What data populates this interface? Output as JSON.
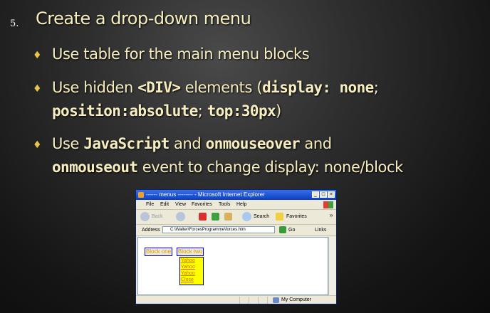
{
  "slide": {
    "number": "5.",
    "title": "Create a drop-down menu",
    "bullets": {
      "b1": {
        "text": "Use table for the main menu blocks"
      },
      "b2": {
        "pre": "Use hidden ",
        "code1": "<DIV>",
        "mid": " elements (",
        "code2": "display:  none",
        "sep": "; ",
        "code3": "position:absolute",
        "sep2": "; ",
        "code4": "top:30px",
        "end": ")"
      },
      "b3": {
        "pre": "Use ",
        "code1": "JavaScript",
        "mid": " and ",
        "code2": "onmouseover",
        "mid2": " and",
        "code3": "onmouseout",
        "end": " event to change display: none/block"
      }
    }
  },
  "browser": {
    "title": "------ menus -------- - Microsoft Internet Explorer",
    "menu": [
      "File",
      "Edit",
      "View",
      "Favorites",
      "Tools",
      "Help"
    ],
    "toolbar": {
      "back": "Back",
      "search": "Search",
      "favorites": "Favorites",
      "more": "»"
    },
    "address": {
      "label": "Address",
      "value": "C:\\Walter\\ForcesProgramme\\forces.htm",
      "go": "Go",
      "links": "Links"
    },
    "page": {
      "block_one": "Block one",
      "block_two": "Block two",
      "dropdown": [
        "Yahoo",
        "Yahoo",
        "Yahoo",
        "Close"
      ]
    },
    "status": "My Computer"
  },
  "colors": {
    "title": "#f7eec0",
    "bullet": "#e8c54a",
    "titlebar": "#0a3fc0",
    "link": "#d07000",
    "dropdown_bg": "#ffff00"
  }
}
